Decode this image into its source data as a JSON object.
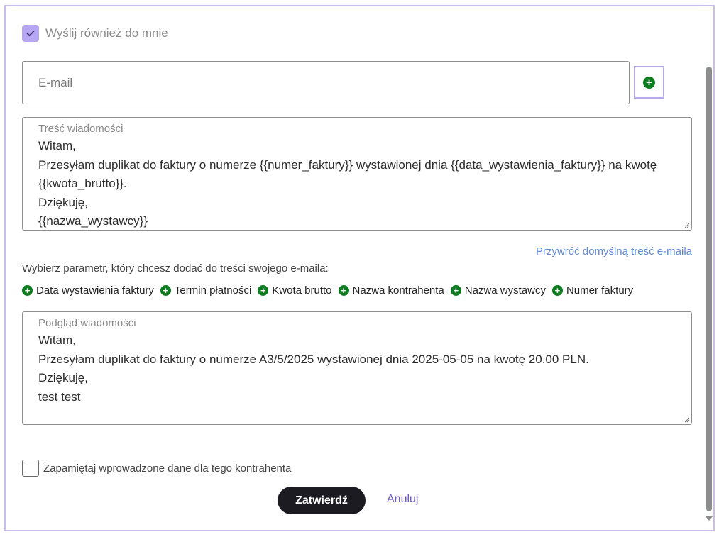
{
  "send_copy": {
    "label": "Wyślij również do mnie",
    "checked": true
  },
  "email": {
    "placeholder": "E-mail",
    "value": ""
  },
  "message": {
    "label": "Treść wiadomości",
    "content": "Witam,\nPrzesyłam duplikat do faktury o numerze {{numer_faktury}} wystawionej dnia {{data_wystawienia_faktury}} na kwotę {{kwota_brutto}}.\nDziękuję,\n{{nazwa_wystawcy}}"
  },
  "restore_link": "Przywróć domyślną treść e-maila",
  "choose_param_text": "Wybierz parametr, który chcesz dodać do treści swojego e-maila:",
  "params": [
    "Data wystawienia faktury",
    "Termin płatności",
    "Kwota brutto",
    "Nazwa kontrahenta",
    "Nazwa wystawcy",
    "Numer faktury"
  ],
  "preview": {
    "label": "Podgląd wiadomości",
    "content": "Witam,\nPrzesyłam duplikat do faktury o numerze A3/5/2025 wystawionej dnia 2025-05-05 na kwotę 20.00 PLN.\nDziękuję,\ntest test"
  },
  "remember": {
    "label": "Zapamiętaj wprowadzone dane dla tego kontrahenta",
    "checked": false
  },
  "buttons": {
    "submit": "Zatwierdź",
    "cancel": "Anuluj"
  },
  "colors": {
    "accent": "#b7a6f3",
    "plus_green": "#0b7d1f",
    "link_blue": "#5e8ad6",
    "dark_button": "#1c1b22"
  }
}
